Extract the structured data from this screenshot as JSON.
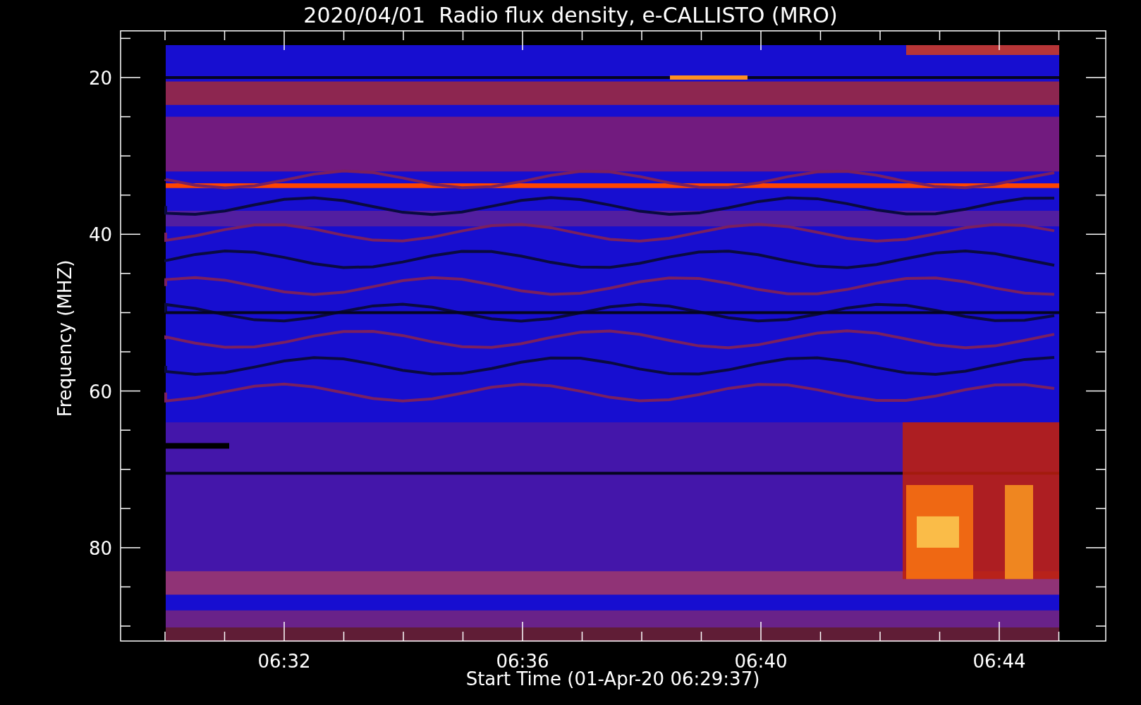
{
  "title": "2020/04/01  Radio flux density, e-CALLISTO (MRO)",
  "ylabel": "Frequency (MHZ)",
  "xlabel": "Start Time (01-Apr-20 06:29:37)",
  "yticks": [
    "20",
    "40",
    "60",
    "80"
  ],
  "xticks": [
    "06:32",
    "06:36",
    "06:40",
    "06:44"
  ]
}
